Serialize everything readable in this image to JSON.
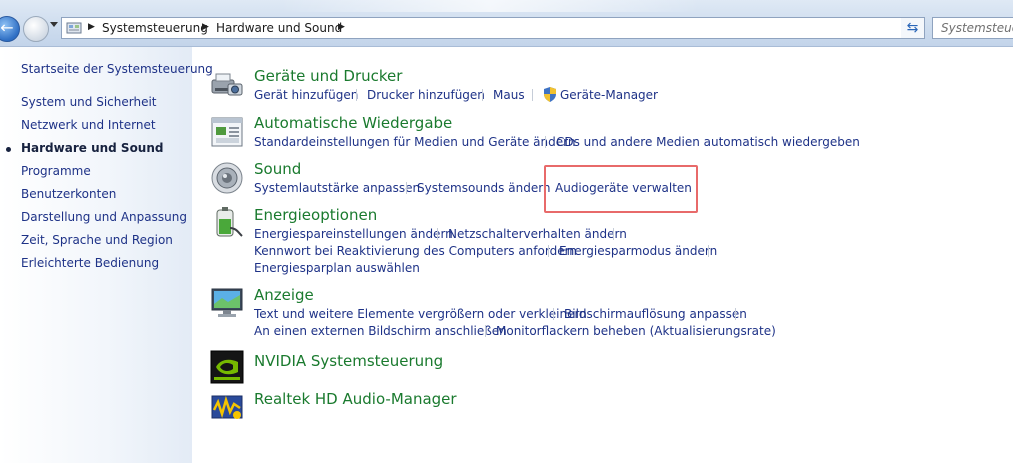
{
  "addressbar": {
    "breadcrumbs": [
      "Systemsteuerung",
      "Hardware und Sound"
    ],
    "search_placeholder": "Systemsteuerung durchsuchen"
  },
  "sidebar": {
    "home": "Startseite der Systemsteuerung",
    "items": [
      {
        "label": "System und Sicherheit"
      },
      {
        "label": "Netzwerk und Internet"
      },
      {
        "label": "Hardware und Sound",
        "active": true
      },
      {
        "label": "Programme"
      },
      {
        "label": "Benutzerkonten"
      },
      {
        "label": "Darstellung und Anpassung"
      },
      {
        "label": "Zeit, Sprache und Region"
      },
      {
        "label": "Erleichterte Bedienung"
      }
    ]
  },
  "categories": {
    "devices": {
      "title": "Geräte und Drucker",
      "icon": "printer-camera-icon",
      "tasks": [
        "Gerät hinzufügen",
        "Drucker hinzufügen",
        "Maus",
        "Geräte-Manager"
      ]
    },
    "autoplay": {
      "title": "Automatische Wiedergabe",
      "icon": "autoplay-icon",
      "tasks": [
        "Standardeinstellungen für Medien und Geräte ändern",
        "CDs und andere Medien automatisch wiedergeben"
      ]
    },
    "sound": {
      "title": "Sound",
      "icon": "speaker-icon",
      "tasks": [
        "Systemlautstärke anpassen",
        "Systemsounds ändern",
        "Audiogeräte verwalten"
      ]
    },
    "power": {
      "title": "Energieoptionen",
      "icon": "battery-icon",
      "tasks": [
        "Energiespareinstellungen ändern",
        "Netzschalterverhalten ändern",
        "Kennwort bei Reaktivierung des Computers anfordern",
        "Energiesparmodus ändern",
        "Energiesparplan auswählen"
      ]
    },
    "display": {
      "title": "Anzeige",
      "icon": "monitor-icon",
      "tasks": [
        "Text und weitere Elemente vergrößern oder verkleinern",
        "Bildschirmauflösung anpassen",
        "An einen externen Bildschirm anschließen",
        "Monitorflackern beheben (Aktualisierungsrate)"
      ]
    },
    "nvidia": {
      "title": "NVIDIA Systemsteuerung",
      "icon": "nvidia-icon"
    },
    "realtek": {
      "title": "Realtek HD Audio-Manager",
      "icon": "realtek-icon"
    }
  },
  "colors": {
    "link": "#1e3287",
    "category_title": "#1a7a2e",
    "highlight_box": "#e86a6a"
  }
}
